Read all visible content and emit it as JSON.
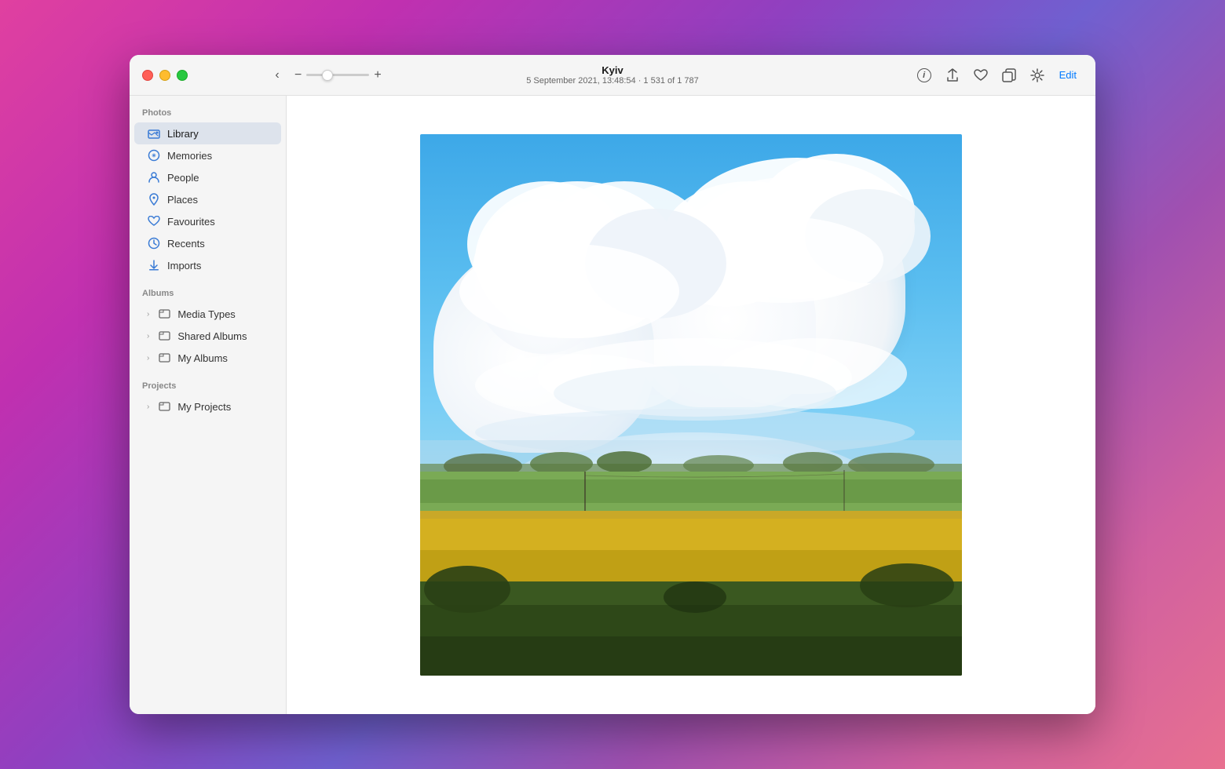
{
  "window": {
    "title": "Kyiv",
    "subtitle": "5 September 2021, 13:48:54  ·  1 531 of 1 787"
  },
  "titlebar": {
    "back_label": "‹",
    "zoom_minus": "−",
    "zoom_plus": "+",
    "info_icon": "ℹ",
    "share_icon": "↑",
    "heart_icon": "♡",
    "duplicate_icon": "⧉",
    "enhance_icon": "✦",
    "edit_label": "Edit"
  },
  "sidebar": {
    "photos_section": "Photos",
    "albums_section": "Albums",
    "projects_section": "Projects",
    "items": [
      {
        "id": "library",
        "label": "Library",
        "active": true
      },
      {
        "id": "memories",
        "label": "Memories",
        "active": false
      },
      {
        "id": "people",
        "label": "People",
        "active": false
      },
      {
        "id": "places",
        "label": "Places",
        "active": false
      },
      {
        "id": "favourites",
        "label": "Favourites",
        "active": false
      },
      {
        "id": "recents",
        "label": "Recents",
        "active": false
      },
      {
        "id": "imports",
        "label": "Imports",
        "active": false
      }
    ],
    "albums_items": [
      {
        "id": "media-types",
        "label": "Media Types"
      },
      {
        "id": "shared-albums",
        "label": "Shared Albums"
      },
      {
        "id": "my-albums",
        "label": "My Albums"
      }
    ],
    "projects_items": [
      {
        "id": "my-projects",
        "label": "My Projects"
      }
    ]
  }
}
